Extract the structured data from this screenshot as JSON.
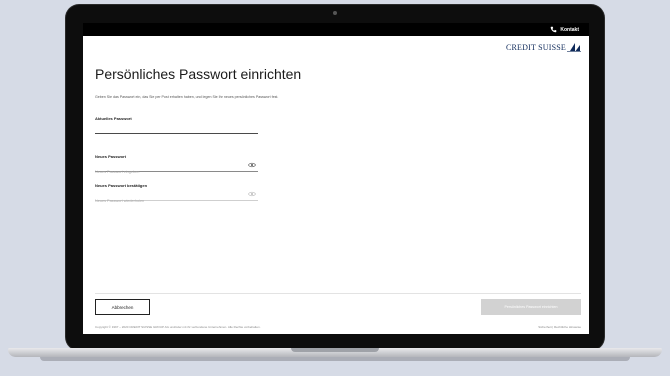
{
  "topbar": {
    "contact_label": "Kontakt",
    "contact_icon": "phone-icon"
  },
  "brand": {
    "logo_text": "CREDIT SUISSE",
    "logo_icon": "sails-icon",
    "color": "#0f2a5a"
  },
  "page": {
    "title": "Persönliches Passwort einrichten",
    "intro": "Geben Sie das Passwort ein, das Sie per Post erhalten haben, und legen Sie Ihr neues persönliches Passwort fest."
  },
  "form": {
    "current_password": {
      "label": "Aktuelles Passwort",
      "value": "",
      "placeholder": ""
    },
    "new_password": {
      "label": "Neues Passwort",
      "value": "",
      "placeholder": "Neues Passwort eingeben"
    },
    "confirm_password": {
      "label": "Neues Passwort bestätigen",
      "value": "",
      "placeholder": "Neues Passwort wiederholen"
    }
  },
  "actions": {
    "cancel_label": "Abbrechen",
    "submit_label": "Persönliches Passwort einrichten"
  },
  "footer": {
    "copyright": "Copyright © 1997 – 2020 CREDIT SUISSE GROUP AG und/oder mit ihr verbundene Unternehmen. Alle Rechte vorbehalten.",
    "links": "Sicherheit | Rechtliche Hinweise"
  }
}
